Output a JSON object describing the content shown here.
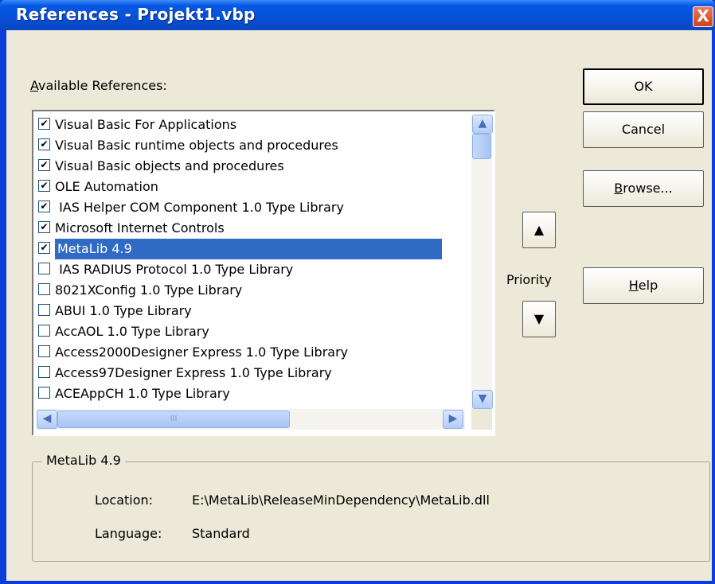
{
  "window": {
    "title": "References - Projekt1.vbp",
    "close_glyph": "X"
  },
  "available_label": {
    "accel": "A",
    "rest": "vailable References:"
  },
  "references": [
    {
      "label": "Visual Basic For Applications",
      "checked": true,
      "selected": false
    },
    {
      "label": "Visual Basic runtime objects and procedures",
      "checked": true,
      "selected": false
    },
    {
      "label": "Visual Basic objects and procedures",
      "checked": true,
      "selected": false
    },
    {
      "label": "OLE Automation",
      "checked": true,
      "selected": false
    },
    {
      "label": " IAS Helper COM Component 1.0 Type Library",
      "checked": true,
      "selected": false
    },
    {
      "label": "Microsoft Internet Controls",
      "checked": true,
      "selected": false
    },
    {
      "label": "MetaLib 4.9",
      "checked": true,
      "selected": true
    },
    {
      "label": " IAS RADIUS Protocol 1.0 Type Library",
      "checked": false,
      "selected": false
    },
    {
      "label": "8021XConfig 1.0 Type Library",
      "checked": false,
      "selected": false
    },
    {
      "label": "ABUI 1.0 Type Library",
      "checked": false,
      "selected": false
    },
    {
      "label": "AccAOL 1.0 Type Library",
      "checked": false,
      "selected": false
    },
    {
      "label": "Access2000Designer Express 1.0 Type Library",
      "checked": false,
      "selected": false
    },
    {
      "label": "Access97Designer Express 1.0 Type Library",
      "checked": false,
      "selected": false
    },
    {
      "label": "ACEAppCH 1.0 Type Library",
      "checked": false,
      "selected": false
    }
  ],
  "buttons": {
    "ok": "OK",
    "cancel": "Cancel",
    "browse_accel": "B",
    "browse_rest": "rowse...",
    "help_accel": "H",
    "help_rest": "elp"
  },
  "priority": {
    "label": "Priority",
    "up_glyph": "▲",
    "down_glyph": "▼"
  },
  "scroll_glyphs": {
    "up": "▲",
    "down": "▼",
    "left": "◀",
    "right": "▶",
    "grip": "III"
  },
  "details": {
    "group_title": "MetaLib 4.9",
    "location_label": "Location:",
    "location_value": "E:\\MetaLib\\ReleaseMinDependency\\MetaLib.dll",
    "language_label": "Language:",
    "language_value": "Standard"
  }
}
